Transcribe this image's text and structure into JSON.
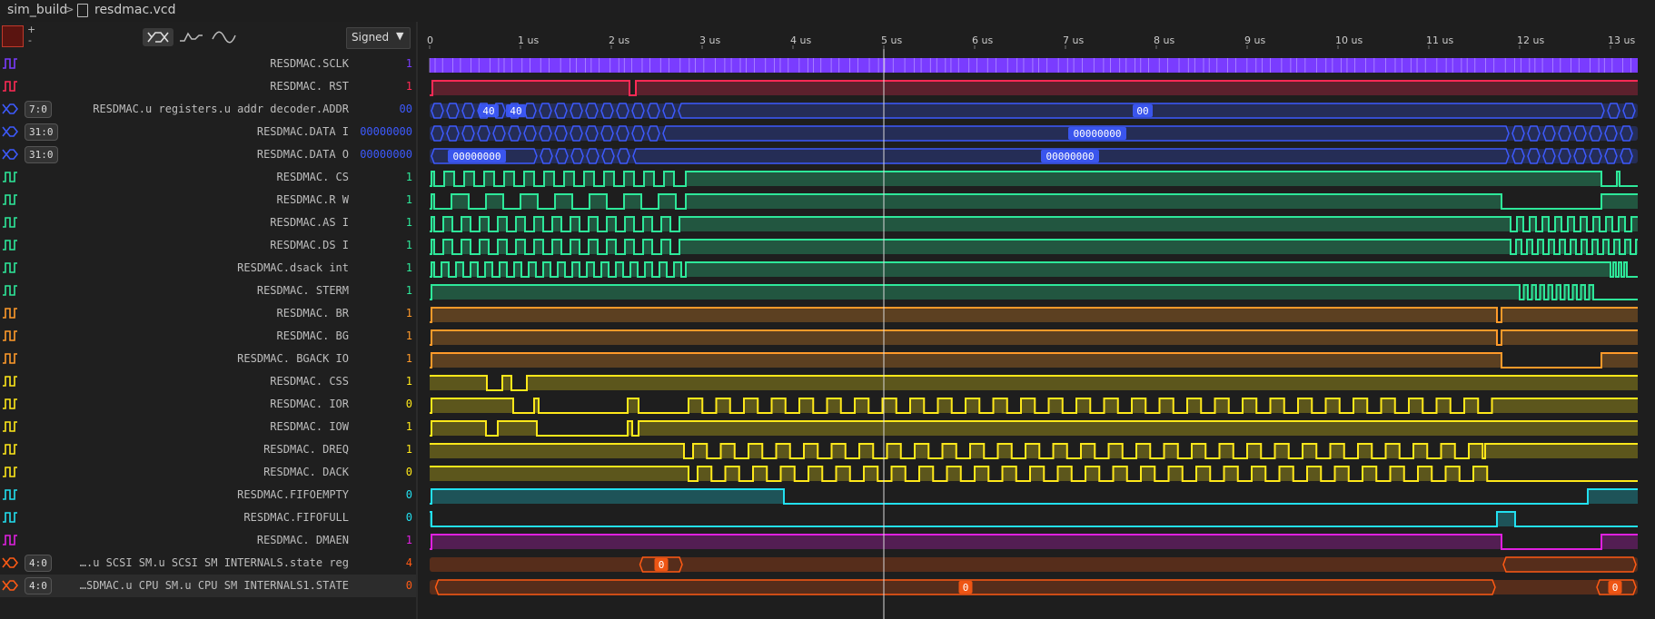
{
  "breadcrumb": {
    "folder": "sim_build",
    "separator": ">",
    "file": "resdmac.vcd"
  },
  "toolbar": {
    "zoom_in": "+",
    "zoom_out": "-",
    "format": "Signed"
  },
  "timeline": {
    "ticks": [
      "0",
      "1 us",
      "2 us",
      "3 us",
      "4 us",
      "5 us",
      "6 us",
      "7 us",
      "8 us",
      "9 us",
      "10 us",
      "11 us",
      "12 us",
      "13 us"
    ],
    "cursor": 5
  },
  "signals": [
    {
      "name": "RESDMAC.SCLK",
      "value": "1",
      "color": "#7a3cff",
      "kind": "clock"
    },
    {
      "name": "RESDMAC. RST",
      "value": "1",
      "color": "#ff2a55",
      "kind": "bit",
      "segs": [
        [
          0.03,
          1
        ],
        [
          2.2,
          0
        ],
        [
          2.27,
          1
        ]
      ],
      "init": 0
    },
    {
      "name": "RESDMAC.u registers.u addr decoder.ADDR",
      "range": "7:0",
      "value": "00",
      "color": "#3d5afe",
      "kind": "bus",
      "labels": [
        [
          "40",
          0.65
        ],
        [
          "40",
          0.95
        ],
        [
          "00",
          7.85
        ]
      ],
      "busy": [
        [
          0,
          2.8
        ],
        [
          12.95,
          13.3
        ]
      ]
    },
    {
      "name": "RESDMAC.DATA I",
      "range": "31:0",
      "value": "00000000",
      "color": "#3d5afe",
      "kind": "bus",
      "labels": [
        [
          "00000000",
          7.35
        ]
      ],
      "busy": [
        [
          0,
          2.7
        ],
        [
          11.9,
          13.3
        ]
      ]
    },
    {
      "name": "RESDMAC.DATA O",
      "range": "31:0",
      "value": "00000000",
      "color": "#3d5afe",
      "kind": "bus",
      "labels": [
        [
          "00000000",
          0.52
        ],
        [
          "00000000",
          7.05
        ]
      ],
      "busy": [
        [
          1.2,
          2.3
        ],
        [
          11.9,
          13.3
        ]
      ]
    },
    {
      "name": "RESDMAC. CS",
      "value": "1",
      "color": "#2ee89a",
      "kind": "pulses",
      "range_t": [
        0,
        2.8
      ],
      "period": 0.22,
      "tail": [
        [
          12.9,
          0
        ],
        [
          13.07,
          1
        ],
        [
          13.1,
          0
        ],
        [
          13.3,
          0
        ]
      ]
    },
    {
      "name": "RESDMAC.R W",
      "value": "1",
      "color": "#2ee89a",
      "kind": "pulses",
      "range_t": [
        0,
        2.8
      ],
      "period": 0.38,
      "tail": [
        [
          11.8,
          0
        ],
        [
          12.9,
          1
        ]
      ]
    },
    {
      "name": "RESDMAC.AS I",
      "value": "1",
      "color": "#2ee89a",
      "kind": "pulses",
      "range_t": [
        0,
        2.8
      ],
      "period": 0.2,
      "tail2": [
        11.9,
        13.3,
        0.14
      ]
    },
    {
      "name": "RESDMAC.DS I",
      "value": "1",
      "color": "#2ee89a",
      "kind": "pulses",
      "range_t": [
        0,
        2.8
      ],
      "period": 0.2,
      "tail2": [
        11.9,
        13.3,
        0.12
      ]
    },
    {
      "name": "RESDMAC.dsack int",
      "value": "1",
      "color": "#2ee89a",
      "kind": "pulses",
      "range_t": [
        0,
        2.8
      ],
      "period": 0.16,
      "tail2": [
        13.0,
        13.2,
        0.06
      ]
    },
    {
      "name": "RESDMAC. STERM",
      "value": "1",
      "color": "#2ee89a",
      "kind": "pulses",
      "range_t": [
        0,
        0
      ],
      "period": 0.2,
      "tail2": [
        12.0,
        12.85,
        0.09
      ]
    },
    {
      "name": "RESDMAC. BR",
      "value": "1",
      "color": "#ff9a2a",
      "kind": "bit",
      "segs": [
        [
          0.02,
          1
        ],
        [
          11.75,
          0
        ],
        [
          11.8,
          1
        ]
      ],
      "init": 0
    },
    {
      "name": "RESDMAC. BG",
      "value": "1",
      "color": "#ff9a2a",
      "kind": "bit",
      "segs": [
        [
          0.02,
          1
        ],
        [
          11.75,
          0
        ],
        [
          11.8,
          1
        ]
      ],
      "init": 0
    },
    {
      "name": "RESDMAC. BGACK IO",
      "value": "1",
      "color": "#ff9a2a",
      "kind": "bit",
      "segs": [
        [
          0.02,
          1
        ],
        [
          11.8,
          0
        ],
        [
          12.9,
          1
        ]
      ],
      "init": 0
    },
    {
      "name": "RESDMAC. CSS",
      "value": "1",
      "color": "#ffe81a",
      "kind": "bit",
      "segs": [
        [
          0.63,
          0
        ],
        [
          0.8,
          1
        ],
        [
          0.9,
          0
        ],
        [
          1.07,
          1
        ]
      ],
      "init": 1
    },
    {
      "name": "RESDMAC. IOR",
      "value": "0",
      "color": "#ffe81a",
      "kind": "iorw",
      "segs": [
        [
          0.02,
          1
        ],
        [
          0.92,
          0
        ],
        [
          1.15,
          1
        ],
        [
          1.2,
          0
        ],
        [
          2.18,
          1
        ],
        [
          2.3,
          0
        ]
      ],
      "start": 2.85,
      "end": 11.75,
      "period": 0.305
    },
    {
      "name": "RESDMAC. IOW",
      "value": "1",
      "color": "#ffe81a",
      "kind": "bit",
      "segs": [
        [
          0.02,
          1
        ],
        [
          0.62,
          0
        ],
        [
          0.75,
          1
        ],
        [
          1.18,
          0
        ],
        [
          2.18,
          1
        ],
        [
          2.23,
          0
        ],
        [
          2.3,
          1
        ]
      ],
      "init": 0
    },
    {
      "name": "RESDMAC. DREQ",
      "value": "1",
      "color": "#ffe81a",
      "kind": "iorw",
      "segs": [
        [
          2.8,
          0
        ]
      ],
      "init": 1,
      "start": 2.9,
      "end": 11.6,
      "period": 0.305,
      "endval": 1
    },
    {
      "name": "RESDMAC. DACK",
      "value": "0",
      "color": "#ffe81a",
      "kind": "iorw",
      "segs": [
        [
          2.85,
          0
        ]
      ],
      "init": 1,
      "start": 2.95,
      "end": 11.75,
      "period": 0.305,
      "endval": 0
    },
    {
      "name": "RESDMAC.FIFOEMPTY",
      "value": "0",
      "color": "#22e0f0",
      "kind": "bit",
      "segs": [
        [
          0.02,
          1
        ],
        [
          3.9,
          0
        ],
        [
          12.75,
          1
        ]
      ],
      "init": 0
    },
    {
      "name": "RESDMAC.FIFOFULL",
      "value": "0",
      "color": "#22e0f0",
      "kind": "bit",
      "segs": [
        [
          0.02,
          0
        ],
        [
          11.75,
          1
        ],
        [
          11.95,
          0
        ]
      ],
      "init": 1
    },
    {
      "name": "RESDMAC. DMAEN",
      "value": "1",
      "color": "#e020e0",
      "kind": "bit",
      "segs": [
        [
          0.02,
          1
        ],
        [
          11.8,
          0
        ],
        [
          12.9,
          1
        ]
      ],
      "init": 0
    },
    {
      "name": "….u SCSI SM.u SCSI SM INTERNALS.state reg",
      "range": "4:0",
      "value": "4",
      "color": "#ff5a14",
      "kind": "bus",
      "labels": [
        [
          "0",
          2.55
        ]
      ],
      "busy": [
        [
          0,
          2.3
        ],
        [
          2.8,
          11.8
        ]
      ],
      "dense": true
    },
    {
      "name": "…SDMAC.u CPU SM.u CPU SM INTERNALS1.STATE",
      "range": "4:0",
      "value": "0",
      "color": "#ff5a14",
      "kind": "bus",
      "labels": [
        [
          "0",
          5.9
        ],
        [
          "0",
          13.05
        ]
      ],
      "busy": [
        [
          0,
          0.05
        ],
        [
          11.75,
          12.85
        ]
      ],
      "dense": true,
      "selected": true
    }
  ]
}
